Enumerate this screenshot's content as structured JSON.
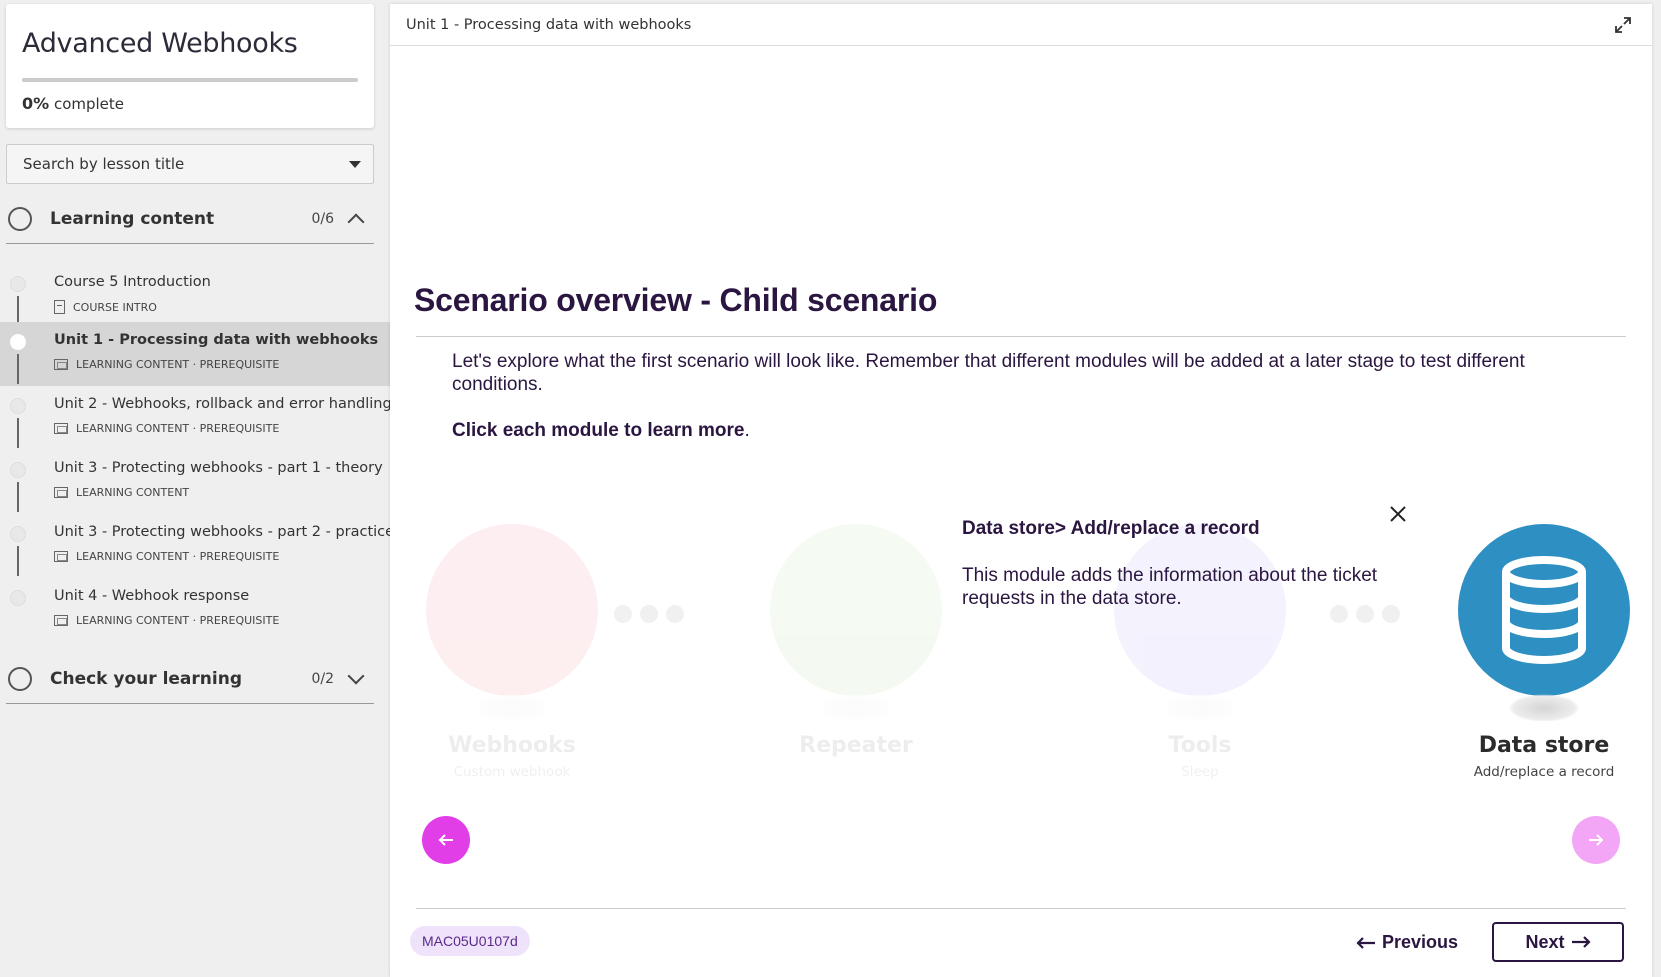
{
  "course": {
    "title": "Advanced Webhooks",
    "progress_percent": "0%",
    "progress_suffix": "complete",
    "progress_fraction": 0
  },
  "search": {
    "label": "Search by lesson title"
  },
  "sections": [
    {
      "label": "Learning content",
      "count": "0/6",
      "expanded": true
    },
    {
      "label": "Check your learning",
      "count": "0/2",
      "expanded": false
    }
  ],
  "lessons": [
    {
      "title": "Course 5 Introduction",
      "meta": "COURSE INTRO",
      "icon": "document-icon"
    },
    {
      "title": "Unit 1 - Processing data with webhooks",
      "meta": "LEARNING CONTENT · PREREQUISITE",
      "icon": "slides-icon",
      "active": true
    },
    {
      "title": "Unit 2 - Webhooks, rollback and error handling",
      "meta": "LEARNING CONTENT · PREREQUISITE",
      "icon": "slides-icon"
    },
    {
      "title": "Unit 3 - Protecting webhooks - part 1 - theory",
      "meta": "LEARNING CONTENT",
      "icon": "slides-icon"
    },
    {
      "title": "Unit 3 - Protecting webhooks - part 2 - practice",
      "meta": "LEARNING CONTENT · PREREQUISITE",
      "icon": "slides-icon"
    },
    {
      "title": "Unit 4 - Webhook response",
      "meta": "LEARNING CONTENT · PREREQUISITE",
      "icon": "slides-icon"
    }
  ],
  "main": {
    "breadcrumb": "Unit 1 - Processing data with webhooks",
    "heading": "Scenario overview - Child scenario",
    "intro": "Let's explore what the first scenario will look like. Remember that different modules will be added at a later stage to test different conditions.",
    "instruction_bold": "Click each module to learn more",
    "instruction_end": "."
  },
  "modules": [
    {
      "name": "Webhooks",
      "sub": "Custom webhook",
      "color": "#e8334a",
      "icon": "webhook-icon"
    },
    {
      "name": "Repeater",
      "sub": "",
      "color": "#7bbf6a",
      "icon": "repeater-icon"
    },
    {
      "name": "Tools",
      "sub": "Sleep",
      "color": "#6c5ce7",
      "icon": "tools-icon"
    },
    {
      "name": "Data store",
      "sub": "Add/replace a record",
      "color": "#2e8fc2",
      "icon": "database-icon"
    }
  ],
  "popup": {
    "title": "Data store> Add/replace a record",
    "body": "This module adds the information about the ticket requests in the data store."
  },
  "footer": {
    "code": "MAC05U0107d",
    "previous_label": "Previous",
    "next_label": "Next"
  },
  "colors": {
    "accent": "#e23ee8",
    "heading": "#2a1640",
    "progress": "#7b3fe4"
  }
}
